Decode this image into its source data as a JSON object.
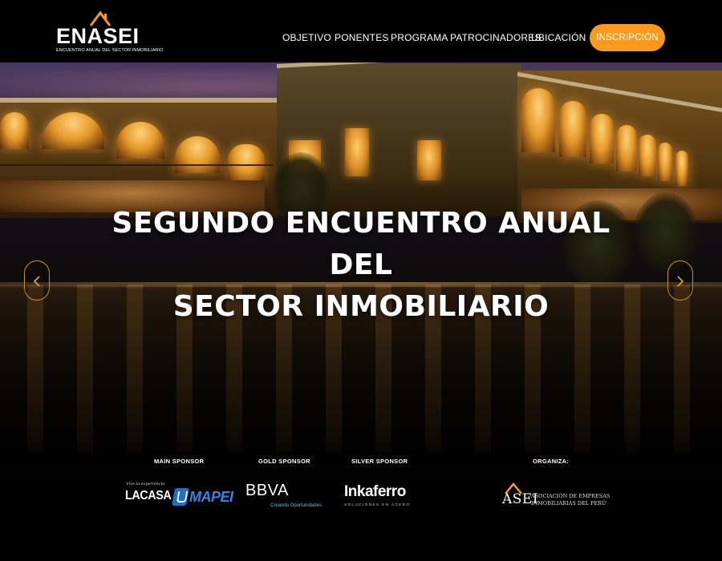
{
  "brand": {
    "name": "ENASEI",
    "tagline": "ENCUENTRO ANUAL DEL SECTOR INMOBILIARIO",
    "accent": "#f99a1c"
  },
  "nav": {
    "items": [
      {
        "label": "OBJETIVO"
      },
      {
        "label": "PONENTES"
      },
      {
        "label": "PROGRAMA"
      },
      {
        "label": "PATROCINADORES"
      },
      {
        "label": "UBICACIÓN"
      }
    ],
    "cta_label": "INSCRIPCIÓN"
  },
  "hero": {
    "title_line1": "SEGUNDO ENCUENTRO ANUAL DEL",
    "title_line2": "SECTOR INMOBILIARIO",
    "prev_icon": "chevron-left-icon",
    "next_icon": "chevron-right-icon"
  },
  "sponsors": {
    "main_label": "MAIN SPONSOR",
    "gold_label": "GOLD SPONSOR",
    "silver_label": "SILVER SPONSOR",
    "organiza_label": "ORGANIZA:",
    "lacosa_pre": "Vive la experiencia",
    "lacosa": "LACASA",
    "mapei": "MAPEI",
    "bbva": "BBVA",
    "bbva_sub": "Creando Oportunidades",
    "inka": "Inkaferro",
    "inka_sub": "SOLUCIONES EN ACERO",
    "asei": "ASEI",
    "asei_desc_line1": "ASOCIACIÓN DE EMPRESAS",
    "asei_desc_line2": "INMOBILIARIAS DEL PERÚ",
    "mapei_color": "#2f86e4",
    "bbva_sub_color": "#4ec0e8"
  }
}
